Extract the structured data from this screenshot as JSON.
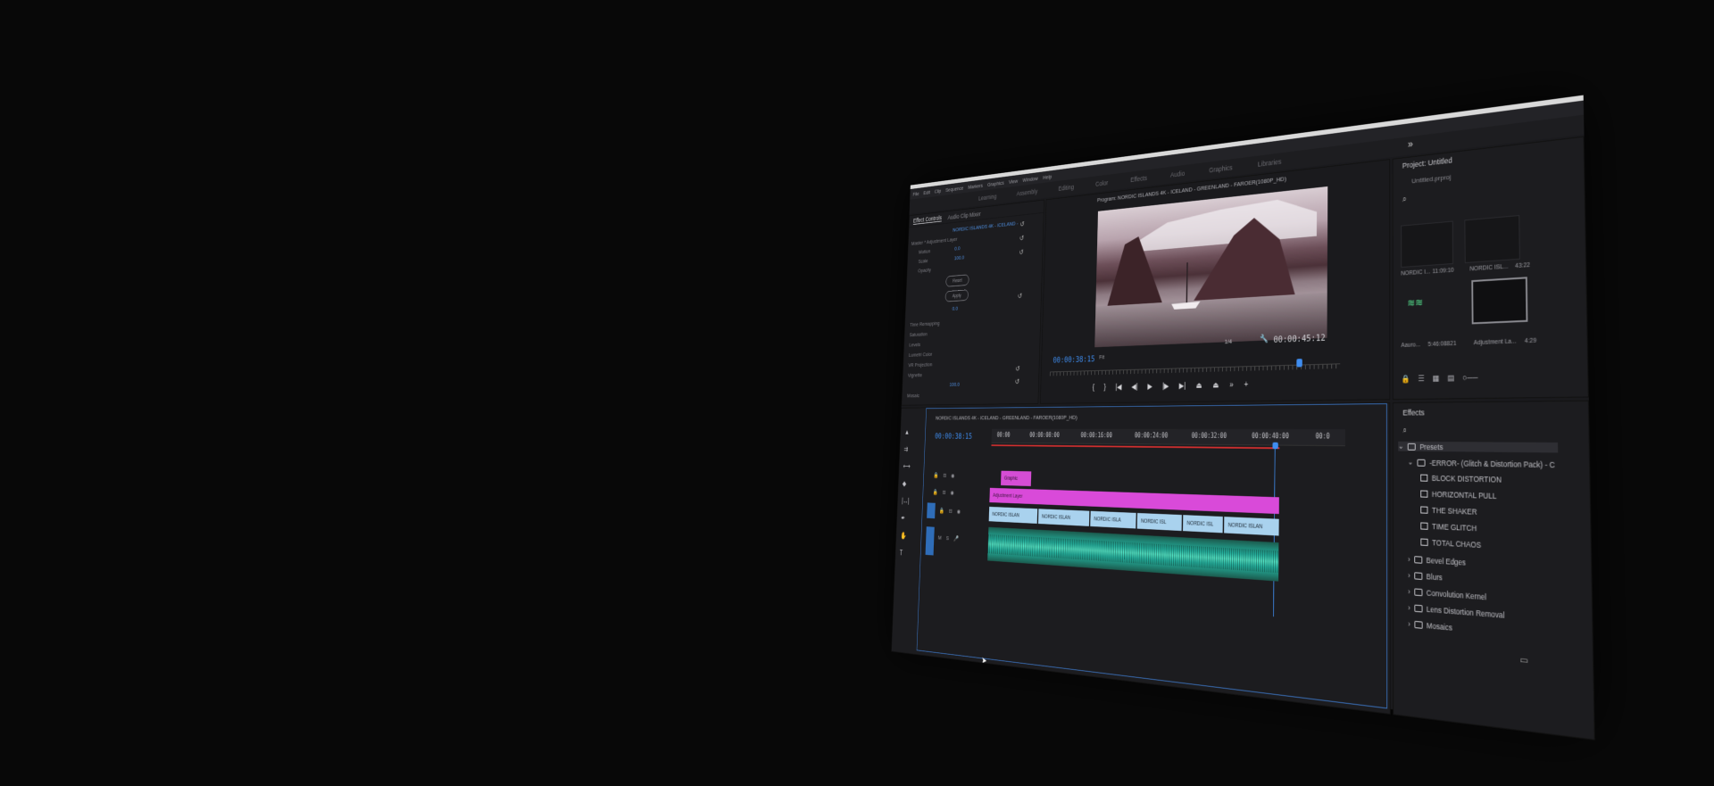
{
  "menu": [
    "File",
    "Edit",
    "Clip",
    "Sequence",
    "Markers",
    "Graphics",
    "View",
    "Window",
    "Help"
  ],
  "workspaces": [
    "Learning",
    "Assembly",
    "Editing",
    "Color",
    "Effects",
    "Audio",
    "Graphics",
    "Libraries"
  ],
  "effect_controls": {
    "tabs": [
      "Effect Controls",
      "Audio Clip Mixer"
    ],
    "source": "NORDIC ISLANDS 4K - ICELAND -",
    "rows": [
      "Master * Adjustment Layer",
      "Motion",
      "Scale",
      "Opacity",
      "Time Remapping",
      "Saturation",
      "Levels",
      "Lumetri Color",
      "VR Projection",
      "Vignette",
      "Mosaic"
    ],
    "values": [
      "0.0",
      "100.0",
      "0.0",
      "100.0"
    ],
    "buttons": [
      "Reset",
      "Apply"
    ]
  },
  "program_monitor": {
    "title": "Program: NORDIC ISLANDS 4K - ICELAND - GREENLAND - FAROER(1080P_HD)",
    "timecode_current": "00:00:38:15",
    "fit": "Fit",
    "resolution": "1/4",
    "timecode_duration": "00:00:45:12"
  },
  "project": {
    "title": "Project: Untitled",
    "file": "Untitled.prproj",
    "items": [
      {
        "name": "NORDIC I...",
        "duration": "11:09:10"
      },
      {
        "name": "NORDIC ISL...",
        "duration": "43:22"
      },
      {
        "name": "Aauro...",
        "duration": "5:46:08821"
      },
      {
        "name": "Adjustment La...",
        "duration": "4:29"
      }
    ]
  },
  "effects": {
    "title": "Effects",
    "presets_label": "Presets",
    "pack_label": "-ERROR- (Glitch & Distortion Pack) - C",
    "presets": [
      "BLOCK DISTORTION",
      "HORIZONTAL PULL",
      "THE SHAKER",
      "TIME GLITCH",
      "TOTAL CHAOS"
    ],
    "folders": [
      "Bevel Edges",
      "Blurs",
      "Convolution Kernel",
      "Lens Distortion Removal",
      "Mosaics"
    ]
  },
  "timeline": {
    "sequence_name": "NORDIC ISLANDS 4K - ICELAND - GREENLAND - FAROER(1080P_HD)",
    "timecode": "00:00:38:15",
    "ruler_labels": [
      "00:00",
      "00:00:08:00",
      "00:00:16:00",
      "00:00:24:00",
      "00:00:32:00",
      "00:00:40:00",
      "00:0"
    ],
    "graphic_clip": "Graphic",
    "adjustment_clip": "Adjustment Layer",
    "video_clips": [
      "NORDIC ISLAN",
      "NORDIC ISLAN",
      "NORDIC ISLA",
      "NORDIC ISL",
      "NORDIC ISL",
      "NORDIC ISLAN"
    ]
  },
  "colors": {
    "accent_blue": "#3f8df0",
    "clip_magenta": "#d94ad9",
    "clip_video": "#a9d2ee",
    "clip_audio": "#25b3a0",
    "playhead_red": "#d12f2f"
  }
}
